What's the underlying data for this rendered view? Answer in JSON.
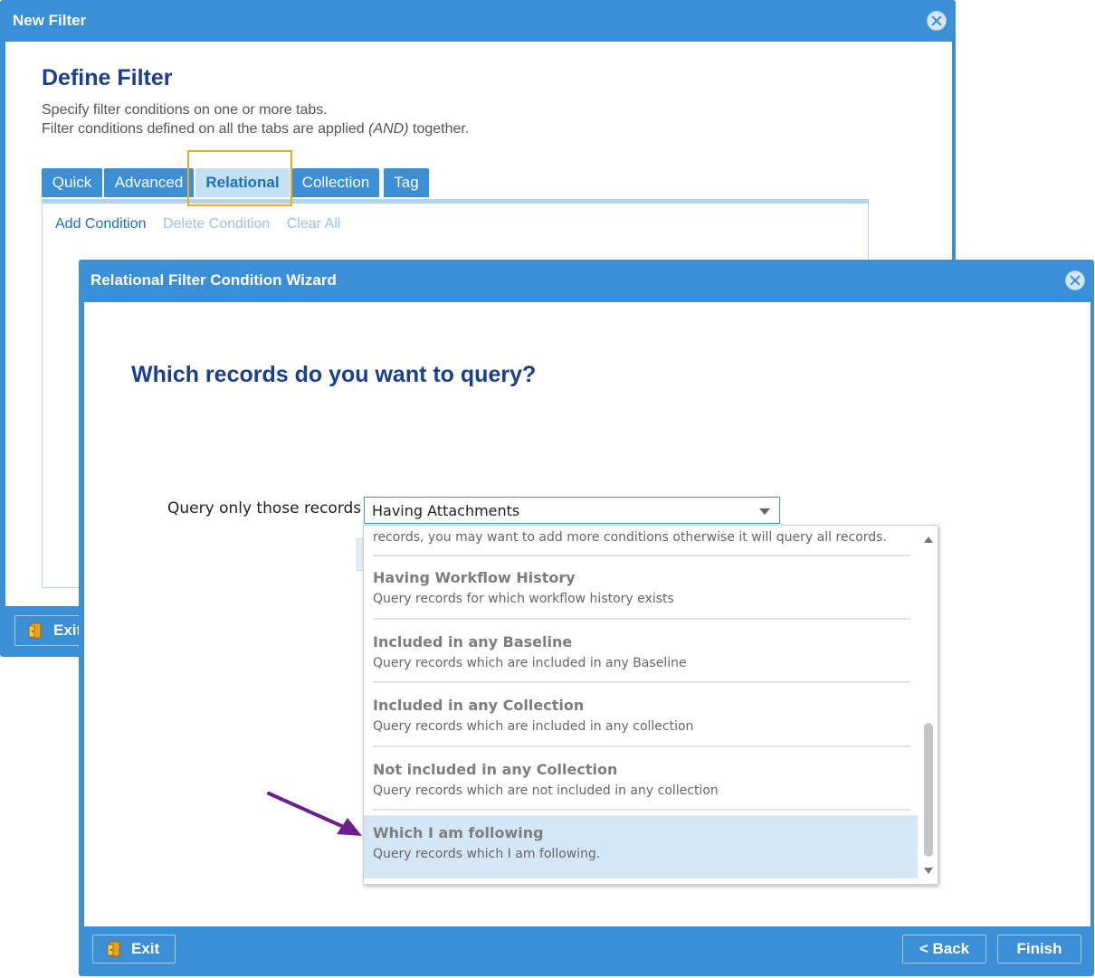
{
  "back_dialog": {
    "title": "New Filter",
    "heading": "Define Filter",
    "desc_line1": "Specify filter conditions on one or more tabs.",
    "desc_line2_prefix": "Filter conditions defined on all the tabs are applied ",
    "desc_line2_em": "(AND)",
    "desc_line2_suffix": " together.",
    "tabs": [
      "Quick",
      "Advanced",
      "Relational",
      "Collection",
      "Tag"
    ],
    "active_tab": "Relational",
    "actions": {
      "add": "Add Condition",
      "delete": "Delete Condition",
      "clear": "Clear All"
    },
    "exit_label": "Exit"
  },
  "wizard": {
    "title": "Relational Filter Condition Wizard",
    "question": "Which records do you want to query?",
    "query_label": "Query only those records",
    "selected_value": "Having Attachments",
    "dropdown": {
      "partial_text": "records, you may want to add more conditions otherwise it will query all records.",
      "items": [
        {
          "title": "Having Workflow History",
          "desc": "Query records for which workflow history exists"
        },
        {
          "title": "Included in any Baseline",
          "desc": "Query records which are included in any Baseline"
        },
        {
          "title": "Included in any Collection",
          "desc": "Query records which are included in any collection"
        },
        {
          "title": "Not included in any Collection",
          "desc": "Query records which are not included in any collection"
        },
        {
          "title": "Which I am following",
          "desc": "Query records which I am following."
        }
      ],
      "highlighted_item": "Which I am following"
    },
    "buttons": {
      "exit": "Exit",
      "back": "< Back",
      "finish": "Finish"
    }
  },
  "colors": {
    "accent": "#3a8fd6",
    "heading": "#1a3f8c",
    "highlight_box": "#f2a81d",
    "annotation_arrow": "#6a1f8a",
    "selected_row": "#d4e7f7"
  }
}
